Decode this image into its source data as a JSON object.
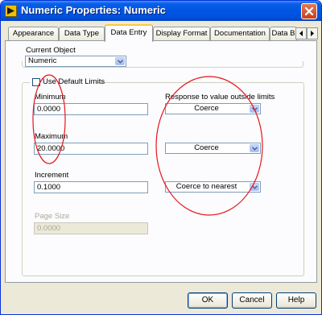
{
  "window": {
    "title": "Numeric Properties: Numeric",
    "app_icon": "labview-vi-icon",
    "close_icon": "close-icon"
  },
  "tabs": [
    {
      "label": "Appearance",
      "active": false
    },
    {
      "label": "Data Type",
      "active": false
    },
    {
      "label": "Data Entry",
      "active": true
    },
    {
      "label": "Display Format",
      "active": false
    },
    {
      "label": "Documentation",
      "active": false
    },
    {
      "label": "Data B",
      "active": false
    }
  ],
  "current_object": {
    "label": "Current Object",
    "value": "Numeric"
  },
  "use_default_limits": {
    "label": "Use Default Limits",
    "checked": false
  },
  "minimum": {
    "label": "Minimum",
    "value": "0.0000"
  },
  "maximum": {
    "label": "Maximum",
    "value": "20.0000"
  },
  "increment": {
    "label": "Increment",
    "value": "0.1000"
  },
  "page_size": {
    "label": "Page Size",
    "value": "0.0000",
    "disabled": true
  },
  "response": {
    "label": "Response to value outside limits",
    "minimum_response": "Coerce",
    "maximum_response": "Coerce",
    "increment_response": "Coerce to nearest"
  },
  "buttons": {
    "ok": "OK",
    "cancel": "Cancel",
    "help": "Help"
  },
  "colors": {
    "titlebar": "#0054e3",
    "annotation": "#e8141a",
    "active_tab_highlight": "#ffc83c"
  }
}
